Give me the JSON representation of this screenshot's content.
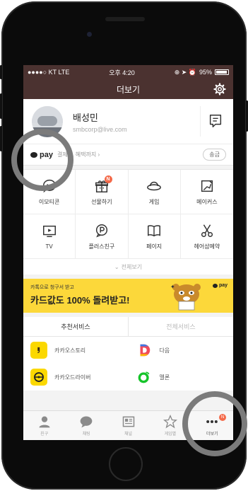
{
  "status": {
    "carrier": "●●●●○ KT  LTE",
    "time": "오후 4:20",
    "battery": "95%"
  },
  "header": {
    "title": "더보기"
  },
  "profile": {
    "name": "배성민",
    "email": "smbcorp@live.com"
  },
  "pay": {
    "logo": "pay",
    "text": "결제 ... 혜택까지 ›",
    "remit": "송금"
  },
  "grid": [
    {
      "label": "이모티콘",
      "icon": "emoticon-icon"
    },
    {
      "label": "선물하기",
      "icon": "gift-icon",
      "badge": "N"
    },
    {
      "label": "게임",
      "icon": "ufo-game-icon"
    },
    {
      "label": "메이커스",
      "icon": "makers-icon"
    },
    {
      "label": "TV",
      "icon": "tv-icon"
    },
    {
      "label": "플러스친구",
      "icon": "plus-friend-icon"
    },
    {
      "label": "페이지",
      "icon": "book-icon"
    },
    {
      "label": "헤어샵예약",
      "icon": "scissors-icon"
    }
  ],
  "view_all": "전체보기",
  "banner": {
    "small": "카톡으로 청구서 받고",
    "big": "카드값도 100% 돌려받고!",
    "pay": "pay"
  },
  "services": {
    "tabs": [
      "추천서비스",
      "전체서비스"
    ],
    "items": [
      {
        "label": "카카오스토리",
        "icon": "kakaostory-icon",
        "color": "#fbd800"
      },
      {
        "label": "다음",
        "icon": "daum-icon",
        "color": "#ffffff"
      },
      {
        "label": "카카오드라이버",
        "icon": "kakaodriver-icon",
        "color": "#fbd800"
      },
      {
        "label": "멜론",
        "icon": "melon-icon",
        "color": "#ffffff"
      }
    ]
  },
  "tabbar": [
    {
      "label": "친구",
      "icon": "person-icon"
    },
    {
      "label": "채팅",
      "icon": "chat-icon"
    },
    {
      "label": "채널",
      "icon": "channel-icon"
    },
    {
      "label": "게임별",
      "icon": "star-icon"
    },
    {
      "label": "더보기",
      "icon": "more-icon",
      "badge": "N",
      "active": true
    }
  ],
  "colors": {
    "header": "#4b3230",
    "badge": "#f46a4a",
    "banner": "#fcd83a",
    "ring": "#7b7b7b"
  }
}
